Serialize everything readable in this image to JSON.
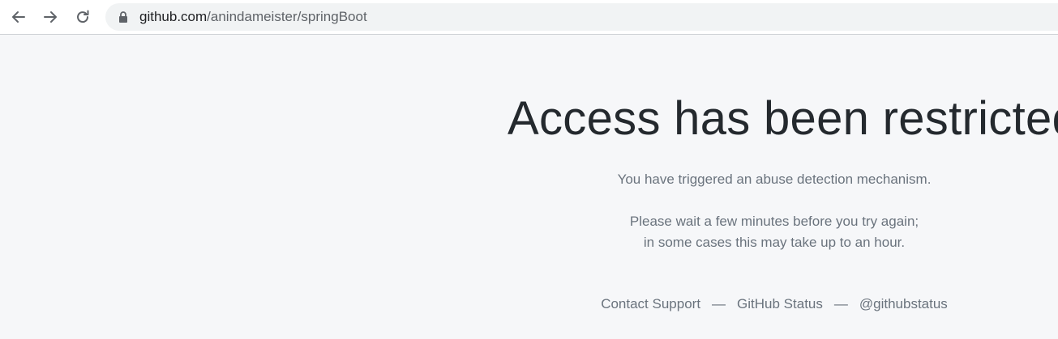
{
  "browser": {
    "url_host": "github.com",
    "url_path": "/anindameister/springBoot",
    "icons": {
      "back": "back-arrow-icon",
      "forward": "forward-arrow-icon",
      "reload": "reload-icon",
      "lock": "lock-icon"
    }
  },
  "page": {
    "headline": "Access has been restricted",
    "message_line1": "You have triggered an abuse detection mechanism.",
    "message_line2": "Please wait a few minutes before you try again;",
    "message_line3": "in some cases this may take up to an hour.",
    "footer": {
      "contact_support": "Contact Support",
      "separator": "—",
      "github_status": "GitHub Status",
      "twitter_handle": "@githubstatus"
    }
  },
  "colors": {
    "page_background": "#f6f7f9",
    "headline_text": "#24292e",
    "body_text": "#6a737d",
    "omnibox_background": "#f1f3f4"
  }
}
